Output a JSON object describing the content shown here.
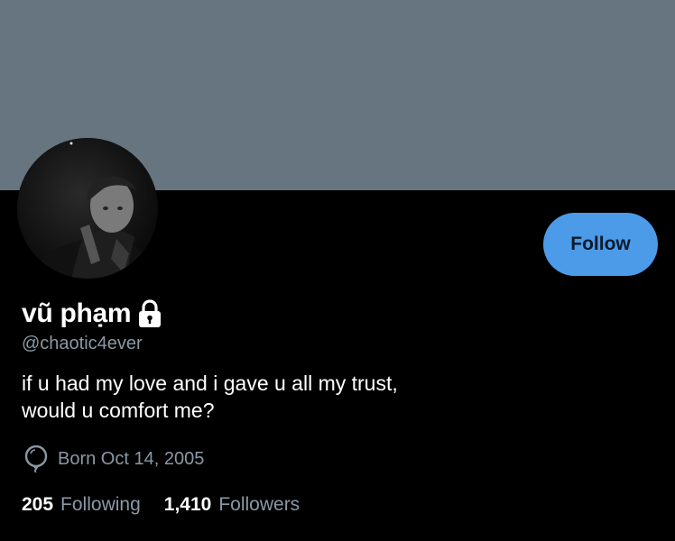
{
  "profile": {
    "display_name": "vũ phạm",
    "handle": "@chaotic4ever",
    "bio_lines": [
      "if u had my love and i gave u all my trust,",
      "would u comfort me?"
    ],
    "birth": "Born Oct 14, 2005",
    "protected_icon": "lock-icon",
    "birth_icon": "balloon-icon"
  },
  "actions": {
    "follow_label": "Follow"
  },
  "stats": {
    "following_count": "205",
    "following_label": "Following",
    "followers_count": "1,410",
    "followers_label": "Followers"
  },
  "colors": {
    "banner": "#66757f",
    "background": "#000000",
    "accent": "#4c9be8",
    "secondary_text": "#8b98a5"
  }
}
